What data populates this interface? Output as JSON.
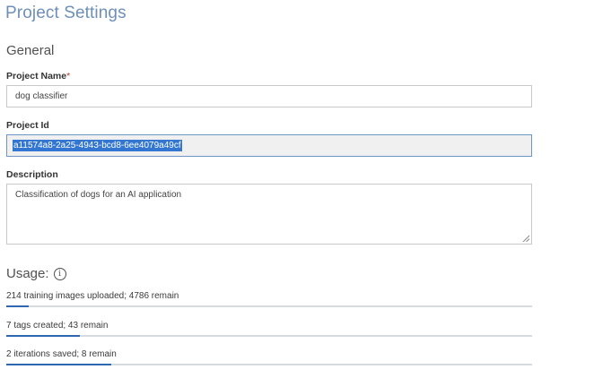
{
  "page": {
    "title": "Project Settings",
    "section": "General"
  },
  "fields": {
    "name": {
      "label": "Project Name",
      "required_marker": "*",
      "value": "dog classifier"
    },
    "id": {
      "label": "Project Id",
      "value": "a11574a8-2a25-4943-bcd8-6ee4079a49cf"
    },
    "description": {
      "label": "Description",
      "value": "Classification of dogs for an AI application"
    }
  },
  "usage": {
    "title": "Usage:",
    "info_icon": "info-icon",
    "items": [
      {
        "text": "214 training images uploaded; 4786 remain",
        "fraction": 0.0428
      },
      {
        "text": "7 tags created; 43 remain",
        "fraction": 0.14
      },
      {
        "text": "2 iterations saved; 8 remain",
        "fraction": 0.2
      }
    ]
  },
  "colors": {
    "title": "#6d8fb8",
    "progress_fill": "#2d68b0",
    "progress_track": "#d6dbe0",
    "selection": "#3276d2",
    "required": "#c0392b"
  }
}
